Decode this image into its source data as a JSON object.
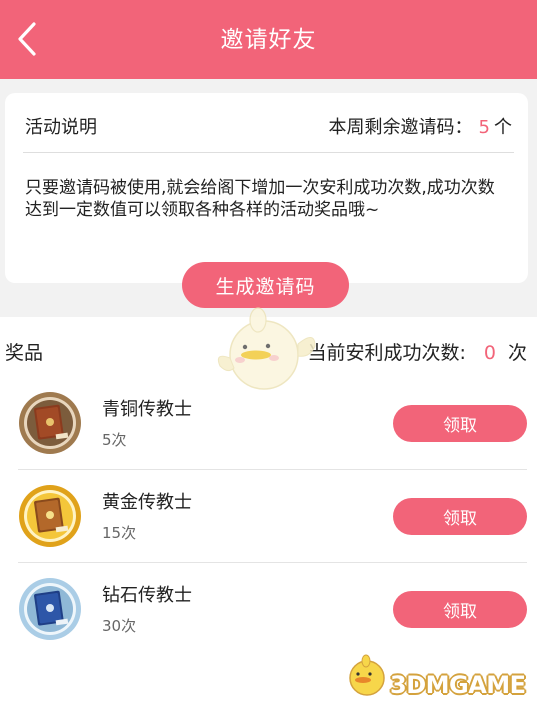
{
  "header": {
    "title": "邀请好友",
    "back_icon": "chevron-left-icon",
    "background_color": "#f26479"
  },
  "activity": {
    "title": "活动说明",
    "remaining_label": "本周剩余邀请码：",
    "remaining_value": "5",
    "remaining_unit": "个",
    "description": "只要邀请码被使用,就会给阁下增加一次安利成功次数,成功次数达到一定数值可以领取各种各样的活动奖品哦~"
  },
  "generate_button": {
    "label": "生成邀请码"
  },
  "prizes_section": {
    "title": "奖品",
    "success_label": "当前安利成功次数:",
    "success_value": "0",
    "success_unit": "次"
  },
  "prizes": [
    {
      "name": "青铜传教士",
      "count": "5次",
      "claim_label": "领取",
      "tier_color": "#b88a55",
      "icon": "bronze-book-medal-icon"
    },
    {
      "name": "黄金传教士",
      "count": "15次",
      "claim_label": "领取",
      "tier_color": "#e7b526",
      "icon": "gold-book-medal-icon"
    },
    {
      "name": "钻石传教士",
      "count": "30次",
      "claim_label": "领取",
      "tier_color": "#9fc8e6",
      "icon": "diamond-book-medal-icon"
    }
  ],
  "watermark": {
    "text": "3DMGAME",
    "icon": "chick-mascot-icon"
  },
  "colors": {
    "accent": "#f26479",
    "band": "#f2f2f2"
  }
}
